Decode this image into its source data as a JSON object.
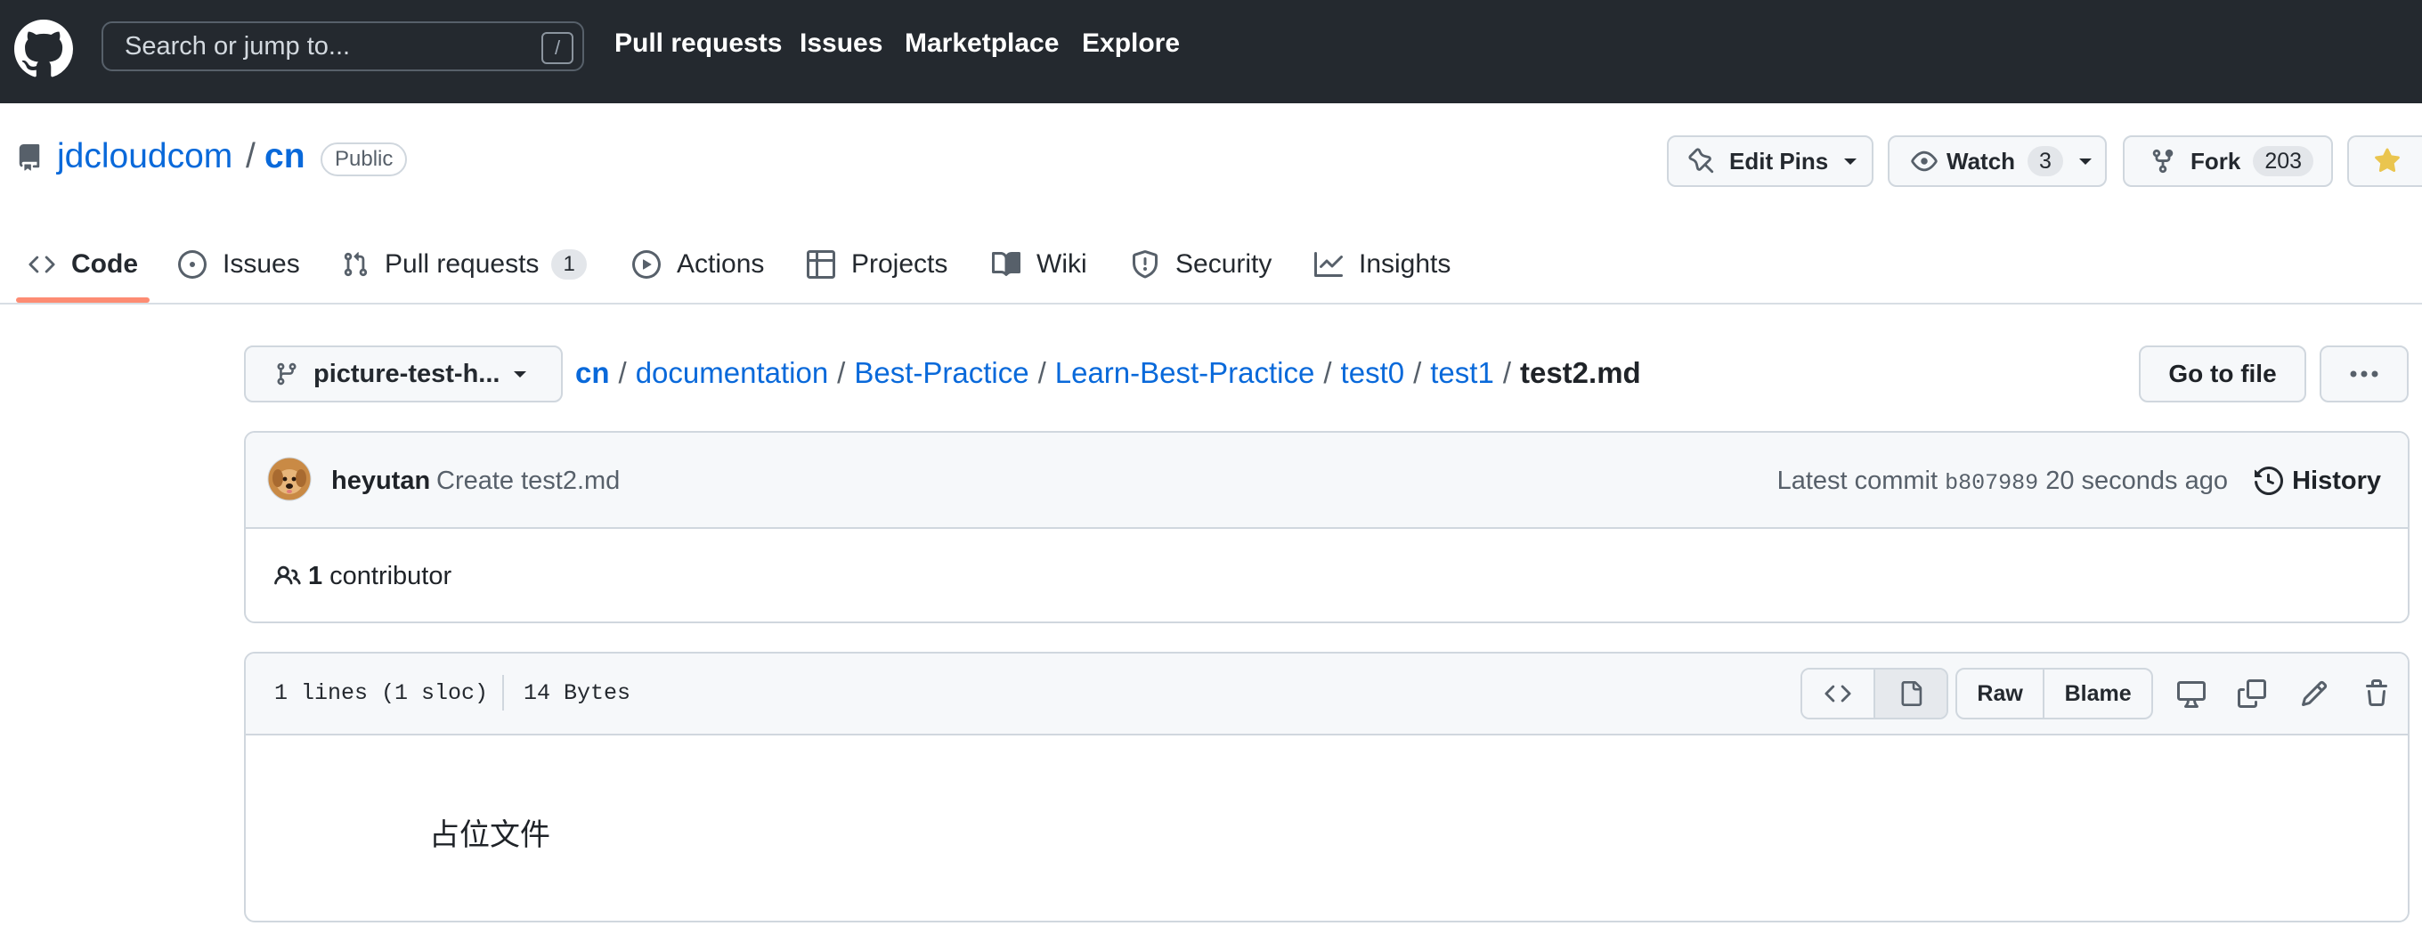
{
  "header": {
    "search_placeholder": "Search or jump to...",
    "search_shortcut": "/",
    "nav": [
      "Pull requests",
      "Issues",
      "Marketplace",
      "Explore"
    ]
  },
  "repo": {
    "owner": "jdcloudcom",
    "separator": "/",
    "name": "cn",
    "visibility": "Public",
    "edit_pins_label": "Edit Pins",
    "watch_label": "Watch",
    "watch_count": "3",
    "fork_label": "Fork",
    "fork_count": "203"
  },
  "tabs": [
    {
      "label": "Code",
      "icon": "code-icon",
      "active": true
    },
    {
      "label": "Issues",
      "icon": "issue-opened-icon"
    },
    {
      "label": "Pull requests",
      "icon": "git-pull-request-icon",
      "count": "1"
    },
    {
      "label": "Actions",
      "icon": "play-icon"
    },
    {
      "label": "Projects",
      "icon": "table-icon"
    },
    {
      "label": "Wiki",
      "icon": "book-icon"
    },
    {
      "label": "Security",
      "icon": "shield-icon"
    },
    {
      "label": "Insights",
      "icon": "graph-icon"
    }
  ],
  "branch": {
    "name": "picture-test-h..."
  },
  "breadcrumb": {
    "root": "cn",
    "dirs": [
      "documentation",
      "Best-Practice",
      "Learn-Best-Practice",
      "test0",
      "test1"
    ],
    "sep": "/",
    "current": "test2.md"
  },
  "actions": {
    "go_to_file": "Go to file"
  },
  "commit": {
    "author": "heyutan",
    "message": "Create test2.md",
    "latest_label": "Latest commit",
    "sha": "b807989",
    "time": "20 seconds ago",
    "history_label": "History"
  },
  "contributors": {
    "count": "1",
    "label": "contributor"
  },
  "file": {
    "lines": "1 lines (1 sloc)",
    "size": "14 Bytes",
    "raw_label": "Raw",
    "blame_label": "Blame",
    "content": "占位文件"
  },
  "colors": {
    "header_bg": "#24292f",
    "link": "#0969da",
    "tab_underline": "#fd8c73",
    "star": "#eac54f"
  }
}
